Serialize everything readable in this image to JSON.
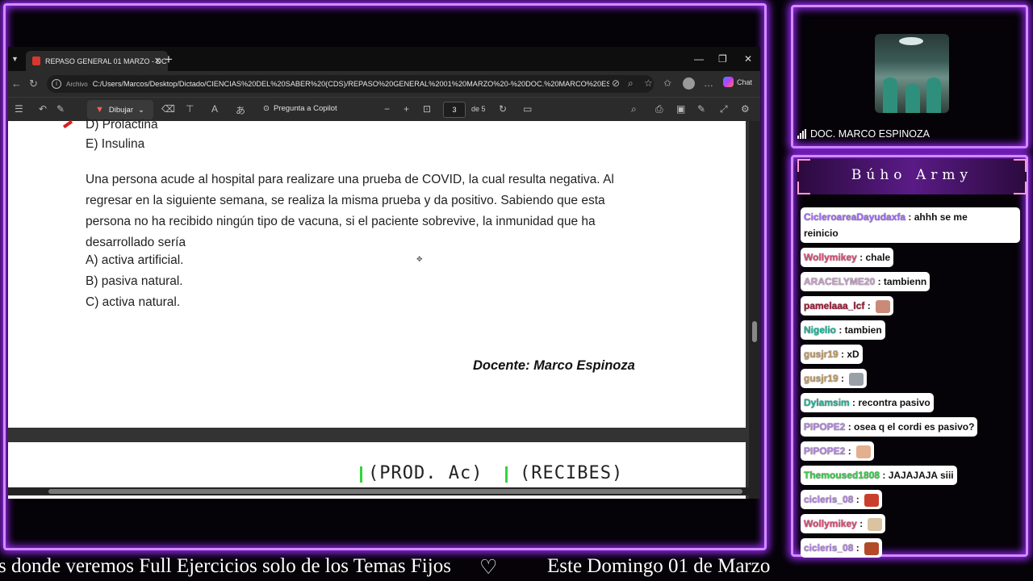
{
  "browser": {
    "tab_title": "REPASO GENERAL 01 MARZO - DC",
    "tab_close": "✕",
    "new_tab": "+",
    "window_controls": [
      "—",
      "❐",
      "✕"
    ],
    "address_chip": "Archivo",
    "url": "C:/Users/Marcos/Desktop/Dictado/CIENCIAS%20DEL%20SABER%20(CDS)/REPASO%20GENERAL%2001%20MARZO%20-%20DOC.%20MARCO%20ES...",
    "copilot_label": "Chat"
  },
  "pdf_toolbar": {
    "draw_label": "Dibujar",
    "ask_copilot": "Pregunta a Copilot",
    "page_current": "3",
    "page_total": "de 5"
  },
  "document": {
    "option_d": "D) Prolactina",
    "option_e": "E) Insulina",
    "question": "Una persona acude al hospital para realizare una prueba de COVID, la cual resulta negativa. Al regresar en la siguiente semana, se realiza la misma prueba y da positivo. Sabiendo que esta persona no ha recibido ningún tipo de vacuna, si el paciente sobrevive, la inmunidad que ha desarrollado sería",
    "options": [
      "A) activa artificial.",
      "B) pasiva natural.",
      "C) activa natural."
    ],
    "signature": "Docente: Marco Espinoza",
    "handwriting_1": "(PROD. Ac)",
    "handwriting_2": "(RECIBES)"
  },
  "ticker": {
    "text_1": "s donde veremos Full Ejercicios solo de los Temas Fijos",
    "heart": "♡",
    "text_2": "Este Domingo 01 de Marzo"
  },
  "camera": {
    "label": "DOC. MARCO ESPINOZA"
  },
  "chat": {
    "title": "Búho Army",
    "messages": [
      {
        "user": "CicleroareaDayudaxfa",
        "text": ": ahhh se me",
        "text2": "reinicio",
        "color": "#a46cff"
      },
      {
        "user": "Wollymikey",
        "text": ": chale",
        "color": "#e0507a"
      },
      {
        "user": "ARACELYME20",
        "text": ": tambienn",
        "color": "#c9a3c9"
      },
      {
        "user": "pamelaaa_lcf",
        "text": ": ",
        "color": "#a0203a",
        "emote": true
      },
      {
        "user": "Nigelio",
        "text": ": tambien",
        "color": "#1fb89a"
      },
      {
        "user": "gusjr19",
        "text": ": xD",
        "color": "#c6a06a"
      },
      {
        "user": "gusjr19",
        "text": ": ",
        "color": "#c6a06a",
        "emote": true
      },
      {
        "user": "Dylamsim",
        "text": ": recontra pasivo",
        "color": "#1fb89a"
      },
      {
        "user": "PIPOPE2",
        "text": ": osea q el cordi es pasivo?",
        "color": "#b488e0"
      },
      {
        "user": "PIPOPE2",
        "text": ": ",
        "color": "#b488e0",
        "emote": true
      },
      {
        "user": "Themoused1808",
        "text": ": JAJAJAJA siii",
        "color": "#3fcf4f"
      },
      {
        "user": "cicleris_08",
        "text": ": ",
        "color": "#b488e0",
        "emote": true
      },
      {
        "user": "Wollymikey",
        "text": ": ",
        "color": "#e0507a",
        "emote": true
      },
      {
        "user": "cicleris_08",
        "text": ": ",
        "color": "#b488e0",
        "emote": true
      }
    ]
  }
}
